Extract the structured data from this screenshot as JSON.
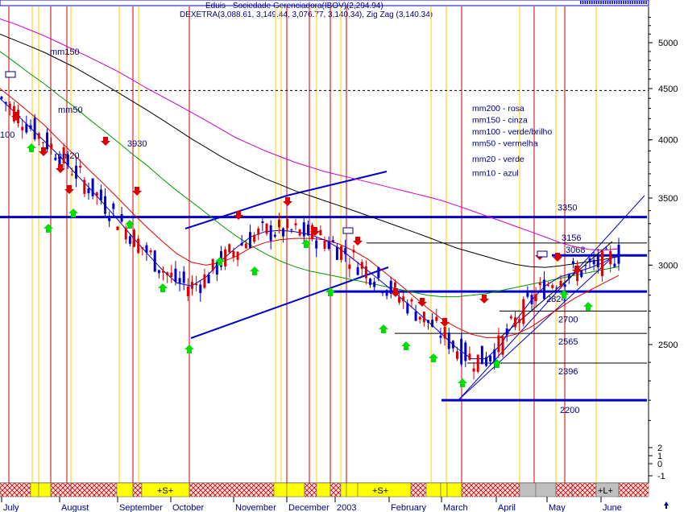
{
  "chart_data": {
    "type": "line",
    "header": {
      "line1": "Eduis  - Sociedade Gerenciadora(IBOV)(2,294.94)",
      "line2": "DEXETRA(3,088.61, 3,149.44, 3,076.77, 3,140.34), Zig Zag (3,140.34)"
    },
    "y_ticks": [
      "5000",
      "4500",
      "4000",
      "3500",
      "3000",
      "2500",
      "2",
      "1",
      "0",
      "-1"
    ],
    "y_tick_values": [
      5000,
      4500,
      4000,
      3500,
      3000,
      2500
    ],
    "lower_ticks": [
      {
        "label": "2",
        "value": 2
      },
      {
        "label": "1",
        "value": 1
      },
      {
        "label": "0",
        "value": 0
      },
      {
        "label": "-1",
        "value": -1
      }
    ],
    "ylim": [
      2000,
      5350
    ],
    "scale": "log",
    "x_labels": [
      "July",
      "August",
      "September",
      "October",
      "November",
      "December",
      "2003",
      "February",
      "March",
      "April",
      "May",
      "June"
    ],
    "ma_labels": [
      "mm150",
      "mm50",
      "mm20",
      "100"
    ],
    "ma_legend": [
      "mm200 - rosa",
      "mm150 - cinza",
      "mm100 - verde/brilho",
      "mm50 - vermelha",
      "mm20 - verde",
      "mm10 - azul"
    ],
    "level_labels": [
      "3930",
      "3350",
      "3156",
      "3068",
      "2824",
      "2700",
      "2565",
      "2396",
      "2200"
    ],
    "levels": [
      {
        "label": "3350",
        "value": 3350,
        "thick": true
      },
      {
        "label": "3156",
        "value": 3156,
        "thick": false
      },
      {
        "label": "3068",
        "value": 3068,
        "thick": true
      },
      {
        "label": "2824",
        "value": 2824,
        "thick": true
      },
      {
        "label": "2700",
        "value": 2700,
        "thick": false
      },
      {
        "label": "2565",
        "value": 2565,
        "thick": false
      },
      {
        "label": "2396",
        "value": 2396,
        "thick": false
      },
      {
        "label": "2200",
        "value": 2200,
        "thick": true
      }
    ],
    "dashed_level": 4480,
    "bar_labels": [
      "+S+",
      "+S+",
      "+L+"
    ],
    "series": [
      {
        "color": "#cc00cc",
        "values": [
          5280,
          5220,
          5150,
          5080,
          5000,
          4920,
          4840,
          4760,
          4680,
          4590,
          4500,
          4420,
          4340,
          4260,
          4180,
          4100,
          4020,
          3960,
          3900,
          3850,
          3800,
          3760,
          3720,
          3690,
          3660,
          3630,
          3600,
          3570,
          3540,
          3510,
          3480,
          3440,
          3400,
          3360,
          3320,
          3280,
          3240,
          3200,
          3160,
          3130,
          3110,
          3105,
          3115
        ]
      },
      {
        "color": "#000000",
        "values": [
          5100,
          5030,
          4960,
          4890,
          4810,
          4730,
          4640,
          4550,
          4460,
          4370,
          4280,
          4190,
          4100,
          4010,
          3930,
          3850,
          3780,
          3720,
          3660,
          3610,
          3560,
          3520,
          3480,
          3440,
          3400,
          3360,
          3320,
          3280,
          3240,
          3200,
          3160,
          3120,
          3090,
          3060,
          3030,
          3005,
          2990,
          2985,
          2995,
          3010,
          3025,
          3040,
          3060
        ]
      },
      {
        "color": "#009900",
        "values": [
          4900,
          4780,
          4660,
          4550,
          4430,
          4320,
          4200,
          4090,
          3980,
          3870,
          3770,
          3660,
          3560,
          3470,
          3380,
          3290,
          3210,
          3140,
          3080,
          3030,
          2990,
          2960,
          2940,
          2920,
          2900,
          2880,
          2860,
          2840,
          2820,
          2800,
          2790,
          2790,
          2800,
          2810,
          2830,
          2850,
          2870,
          2890,
          2910,
          2930,
          2950,
          2970,
          2990
        ]
      },
      {
        "color": "#dd0000",
        "values": [
          4500,
          4380,
          4260,
          4140,
          4000,
          3870,
          3740,
          3620,
          3500,
          3380,
          3270,
          3170,
          3080,
          3020,
          3000,
          3020,
          3060,
          3120,
          3160,
          3180,
          3190,
          3190,
          3180,
          3150,
          3100,
          3040,
          2960,
          2880,
          2800,
          2720,
          2650,
          2600,
          2560,
          2540,
          2540,
          2560,
          2600,
          2660,
          2720,
          2780,
          2830,
          2880,
          2930
        ]
      },
      {
        "color": "#0000cc",
        "values": [
          4400,
          4260,
          4120,
          3990,
          3860,
          3720,
          3590,
          3460,
          3330,
          3200,
          3080,
          2970,
          2880,
          2860,
          2920,
          3030,
          3120,
          3200,
          3240,
          3250,
          3240,
          3220,
          3180,
          3120,
          3040,
          2960,
          2880,
          2800,
          2720,
          2640,
          2560,
          2480,
          2420,
          2420,
          2500,
          2640,
          2760,
          2860,
          2920,
          2950,
          2980,
          3020,
          3080
        ]
      }
    ]
  }
}
